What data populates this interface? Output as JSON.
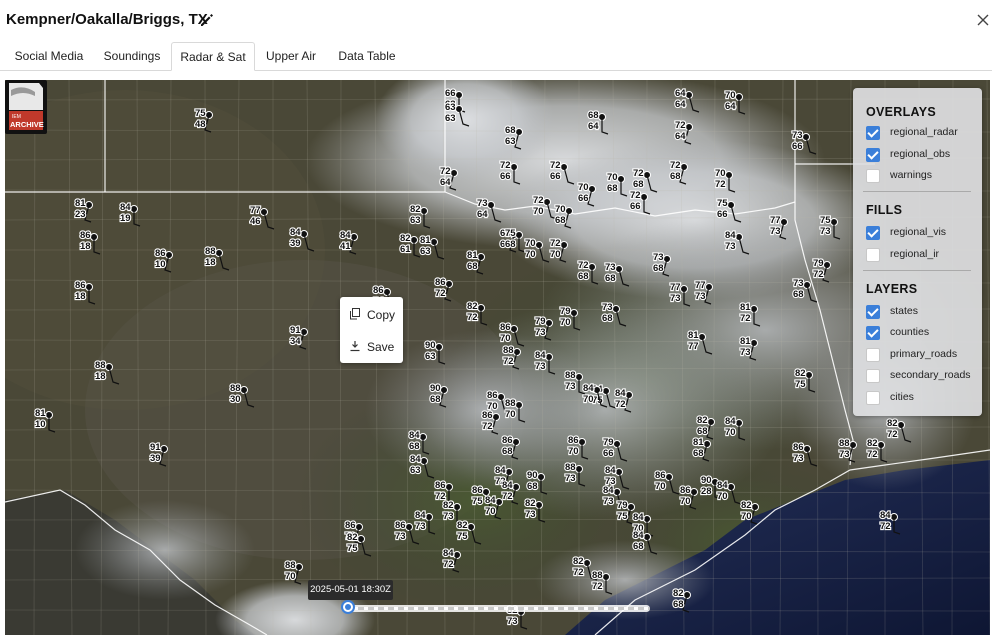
{
  "header": {
    "title": "Kempner/Oakalla/Briggs, TX"
  },
  "tabs": [
    {
      "label": "Social Media"
    },
    {
      "label": "Soundings"
    },
    {
      "label": "Radar & Sat"
    },
    {
      "label": "Upper Air"
    },
    {
      "label": "Data Table"
    }
  ],
  "active_tab": "Radar & Sat",
  "logo": {
    "top_text": "IEM",
    "bottom_text": "ARCHIVE"
  },
  "panel": {
    "overlays_heading": "OVERLAYS",
    "overlays": [
      {
        "label": "regional_radar",
        "checked": true
      },
      {
        "label": "regional_obs",
        "checked": true
      },
      {
        "label": "warnings",
        "checked": false
      }
    ],
    "fills_heading": "FILLS",
    "fills": [
      {
        "label": "regional_vis",
        "checked": true
      },
      {
        "label": "regional_ir",
        "checked": false
      }
    ],
    "layers_heading": "LAYERS",
    "layers": [
      {
        "label": "states",
        "checked": true
      },
      {
        "label": "counties",
        "checked": true
      },
      {
        "label": "primary_roads",
        "checked": false
      },
      {
        "label": "secondary_roads",
        "checked": false
      },
      {
        "label": "cities",
        "checked": false
      }
    ]
  },
  "context_menu": {
    "copy_label": "Copy",
    "save_label": "Save"
  },
  "timeline": {
    "time_label": "2025-05-01 18:30Z",
    "position": 0.02
  },
  "station_obs": [
    {
      "t": "75",
      "d": "48"
    },
    {
      "t": "66",
      "d": "63"
    },
    {
      "t": "63",
      "d": "63"
    },
    {
      "t": "68",
      "d": "63"
    },
    {
      "t": "68",
      "d": "64"
    },
    {
      "t": "64",
      "d": "64"
    },
    {
      "t": "72",
      "d": "64"
    },
    {
      "t": "70",
      "d": "64"
    },
    {
      "t": "73",
      "d": "66"
    },
    {
      "t": "81",
      "d": "23"
    },
    {
      "t": "84",
      "d": "19"
    },
    {
      "t": "77",
      "d": "46"
    },
    {
      "t": "72",
      "d": "64"
    },
    {
      "t": "72",
      "d": "66"
    },
    {
      "t": "72",
      "d": "66"
    },
    {
      "t": "70",
      "d": "66"
    },
    {
      "t": "70",
      "d": "68"
    },
    {
      "t": "72",
      "d": "68"
    },
    {
      "t": "72",
      "d": "68"
    },
    {
      "t": "70",
      "d": "72"
    },
    {
      "t": "72",
      "d": "70"
    },
    {
      "t": "70",
      "d": "68"
    },
    {
      "t": "86",
      "d": "18"
    },
    {
      "t": "84",
      "d": "39"
    },
    {
      "t": "84",
      "d": "41"
    },
    {
      "t": "82",
      "d": "63"
    },
    {
      "t": "73",
      "d": "64"
    },
    {
      "t": "68",
      "d": "63"
    },
    {
      "t": "72",
      "d": "66"
    },
    {
      "t": "75",
      "d": "66"
    },
    {
      "t": "77",
      "d": "73"
    },
    {
      "t": "75",
      "d": "73"
    },
    {
      "t": "88",
      "d": "18"
    },
    {
      "t": "86",
      "d": "10"
    },
    {
      "t": "82",
      "d": "61"
    },
    {
      "t": "81",
      "d": "63"
    },
    {
      "t": "81",
      "d": "68"
    },
    {
      "t": "75",
      "d": "68"
    },
    {
      "t": "70",
      "d": "70"
    },
    {
      "t": "72",
      "d": "70"
    },
    {
      "t": "72",
      "d": "68"
    },
    {
      "t": "84",
      "d": "73"
    },
    {
      "t": "79",
      "d": "72"
    },
    {
      "t": "86",
      "d": "18"
    },
    {
      "t": "86",
      "d": "54"
    },
    {
      "t": "86",
      "d": "72"
    },
    {
      "t": "82",
      "d": "72"
    },
    {
      "t": "73",
      "d": "68"
    },
    {
      "t": "73",
      "d": "68"
    },
    {
      "t": "77",
      "d": "73"
    },
    {
      "t": "73",
      "d": "68"
    },
    {
      "t": "91",
      "d": "34"
    },
    {
      "t": "90",
      "d": "63"
    },
    {
      "t": "86",
      "d": "70"
    },
    {
      "t": "79",
      "d": "73"
    },
    {
      "t": "79",
      "d": "70"
    },
    {
      "t": "73",
      "d": "68"
    },
    {
      "t": "77",
      "d": "73"
    },
    {
      "t": "81",
      "d": "72"
    },
    {
      "t": "88",
      "d": "18"
    },
    {
      "t": "88",
      "d": "72"
    },
    {
      "t": "84",
      "d": "73"
    },
    {
      "t": "81",
      "d": "77"
    },
    {
      "t": "81",
      "d": "73"
    },
    {
      "t": "82",
      "d": "75"
    },
    {
      "t": "88",
      "d": "30"
    },
    {
      "t": "90",
      "d": "68"
    },
    {
      "t": "88",
      "d": "73"
    },
    {
      "t": "84",
      "d": "75"
    },
    {
      "t": "84",
      "d": "72"
    },
    {
      "t": "81",
      "d": "10"
    },
    {
      "t": "86",
      "d": "70"
    },
    {
      "t": "86",
      "d": "72"
    },
    {
      "t": "88",
      "d": "70"
    },
    {
      "t": "84",
      "d": "70"
    },
    {
      "t": "91",
      "d": "39"
    },
    {
      "t": "84",
      "d": "68"
    },
    {
      "t": "84",
      "d": "63"
    },
    {
      "t": "86",
      "d": "68"
    },
    {
      "t": "86",
      "d": "70"
    },
    {
      "t": "79",
      "d": "66"
    },
    {
      "t": "82",
      "d": "68"
    },
    {
      "t": "88",
      "d": "73"
    },
    {
      "t": "84",
      "d": "73"
    },
    {
      "t": "81",
      "d": "68"
    },
    {
      "t": "84",
      "d": "70"
    },
    {
      "t": "86",
      "d": "73"
    },
    {
      "t": "88",
      "d": "73"
    },
    {
      "t": "82",
      "d": "72"
    },
    {
      "t": "82",
      "d": "72"
    },
    {
      "t": "84",
      "d": "72"
    },
    {
      "t": "90",
      "d": "68"
    },
    {
      "t": "86",
      "d": "70"
    },
    {
      "t": "86",
      "d": "70"
    },
    {
      "t": "90",
      "d": "28"
    },
    {
      "t": "84",
      "d": "70"
    },
    {
      "t": "82",
      "d": "70"
    },
    {
      "t": "86",
      "d": "72"
    },
    {
      "t": "86",
      "d": "75"
    },
    {
      "t": "84",
      "d": "72"
    },
    {
      "t": "84",
      "d": "73"
    },
    {
      "t": "86",
      "d": "73"
    },
    {
      "t": "86",
      "d": "70"
    },
    {
      "t": "82",
      "d": "73"
    },
    {
      "t": "82",
      "d": "75"
    },
    {
      "t": "84",
      "d": "70"
    },
    {
      "t": "82",
      "d": "73"
    },
    {
      "t": "84",
      "d": "73"
    },
    {
      "t": "79",
      "d": "75"
    },
    {
      "t": "84",
      "d": "70"
    },
    {
      "t": "82",
      "d": "72"
    },
    {
      "t": "84",
      "d": "72"
    },
    {
      "t": "88",
      "d": "72"
    },
    {
      "t": "84",
      "d": "68"
    },
    {
      "t": "82",
      "d": "68"
    },
    {
      "t": "82",
      "d": "73"
    },
    {
      "t": "82",
      "d": "75"
    },
    {
      "t": "88",
      "d": "70"
    },
    {
      "t": "84",
      "d": "72"
    }
  ]
}
